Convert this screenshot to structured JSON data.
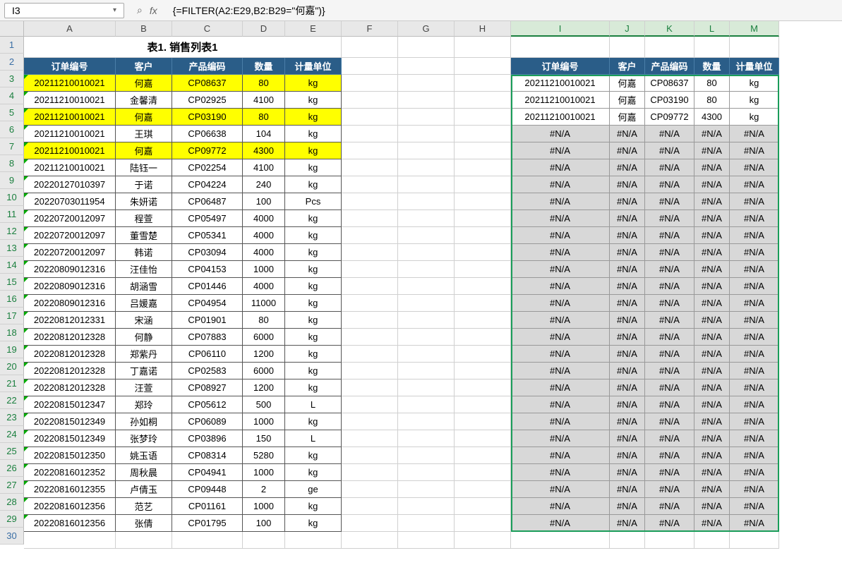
{
  "cellRef": "I3",
  "formula": "{=FILTER(A2:E29,B2:B29=\"何嘉\")}",
  "fxLabel": "fx",
  "cols": [
    "A",
    "B",
    "C",
    "D",
    "E",
    "F",
    "G",
    "H",
    "I",
    "J",
    "K",
    "L",
    "M"
  ],
  "activeCols": [
    "I",
    "J",
    "K",
    "L",
    "M"
  ],
  "title": "表1. 销售列表1",
  "headers1": [
    "订单编号",
    "客户",
    "产品编码",
    "数量",
    "计量单位"
  ],
  "headers2": [
    "订单编号",
    "客户",
    "产品编码",
    "数量",
    "计量单位"
  ],
  "rows1": [
    {
      "d": [
        "20211210010021",
        "何嘉",
        "CP08637",
        "80",
        "kg"
      ],
      "hl": true
    },
    {
      "d": [
        "20211210010021",
        "金馨清",
        "CP02925",
        "4100",
        "kg"
      ]
    },
    {
      "d": [
        "20211210010021",
        "何嘉",
        "CP03190",
        "80",
        "kg"
      ],
      "hl": true
    },
    {
      "d": [
        "20211210010021",
        "王琪",
        "CP06638",
        "104",
        "kg"
      ]
    },
    {
      "d": [
        "20211210010021",
        "何嘉",
        "CP09772",
        "4300",
        "kg"
      ],
      "hl": true
    },
    {
      "d": [
        "20211210010021",
        "陆钰一",
        "CP02254",
        "4100",
        "kg"
      ]
    },
    {
      "d": [
        "20220127010397",
        "于诺",
        "CP04224",
        "240",
        "kg"
      ]
    },
    {
      "d": [
        "20220703011954",
        "朱妍诺",
        "CP06487",
        "100",
        "Pcs"
      ]
    },
    {
      "d": [
        "20220720012097",
        "程萱",
        "CP05497",
        "4000",
        "kg"
      ]
    },
    {
      "d": [
        "20220720012097",
        "董雪楚",
        "CP05341",
        "4000",
        "kg"
      ]
    },
    {
      "d": [
        "20220720012097",
        "韩诺",
        "CP03094",
        "4000",
        "kg"
      ]
    },
    {
      "d": [
        "20220809012316",
        "汪佳怡",
        "CP04153",
        "1000",
        "kg"
      ]
    },
    {
      "d": [
        "20220809012316",
        "胡涵雪",
        "CP01446",
        "4000",
        "kg"
      ]
    },
    {
      "d": [
        "20220809012316",
        "吕媛嘉",
        "CP04954",
        "11000",
        "kg"
      ]
    },
    {
      "d": [
        "20220812012331",
        "宋涵",
        "CP01901",
        "80",
        "kg"
      ]
    },
    {
      "d": [
        "20220812012328",
        "何静",
        "CP07883",
        "6000",
        "kg"
      ]
    },
    {
      "d": [
        "20220812012328",
        "郑紫丹",
        "CP06110",
        "1200",
        "kg"
      ]
    },
    {
      "d": [
        "20220812012328",
        "丁嘉诺",
        "CP02583",
        "6000",
        "kg"
      ]
    },
    {
      "d": [
        "20220812012328",
        "汪萱",
        "CP08927",
        "1200",
        "kg"
      ]
    },
    {
      "d": [
        "20220815012347",
        "郑玲",
        "CP05612",
        "500",
        "L"
      ]
    },
    {
      "d": [
        "20220815012349",
        "孙如桐",
        "CP06089",
        "1000",
        "kg"
      ]
    },
    {
      "d": [
        "20220815012349",
        "张梦玲",
        "CP03896",
        "150",
        "L"
      ]
    },
    {
      "d": [
        "20220815012350",
        "姚玉语",
        "CP08314",
        "5280",
        "kg"
      ]
    },
    {
      "d": [
        "20220816012352",
        "周秋晨",
        "CP04941",
        "1000",
        "kg"
      ]
    },
    {
      "d": [
        "20220816012355",
        "卢倩玉",
        "CP09448",
        "2",
        "ge"
      ]
    },
    {
      "d": [
        "20220816012356",
        "范艺",
        "CP01161",
        "1000",
        "kg"
      ]
    },
    {
      "d": [
        "20220816012356",
        "张倩",
        "CP01795",
        "100",
        "kg"
      ]
    }
  ],
  "rows2": [
    [
      "20211210010021",
      "何嘉",
      "CP08637",
      "80",
      "kg"
    ],
    [
      "20211210010021",
      "何嘉",
      "CP03190",
      "80",
      "kg"
    ],
    [
      "20211210010021",
      "何嘉",
      "CP09772",
      "4300",
      "kg"
    ]
  ],
  "naText": "#N/A",
  "naRows": 24,
  "lastRow": 30
}
